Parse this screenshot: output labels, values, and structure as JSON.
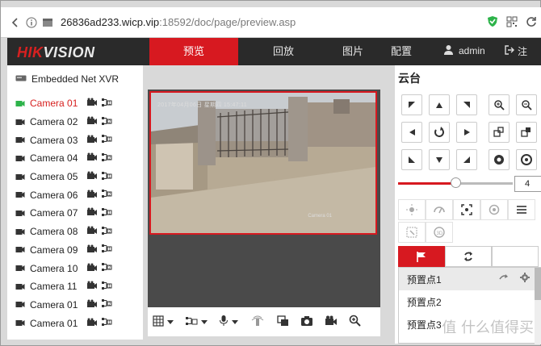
{
  "browser": {
    "url_host": "26836ad233.wicp.vip",
    "url_path": ":18592/doc/page/preview.asp"
  },
  "header": {
    "logo_part1": "HIK",
    "logo_part2": "VISION",
    "tabs": [
      {
        "label": "预览",
        "active": true
      },
      {
        "label": "回放"
      },
      {
        "label": "图片"
      },
      {
        "label": "配置"
      }
    ],
    "user": "admin",
    "logout": "注"
  },
  "left": {
    "device": "Embedded Net XVR",
    "cameras": [
      {
        "name": "Camera 01",
        "active": true
      },
      {
        "name": "Camera 02"
      },
      {
        "name": "Camera 03"
      },
      {
        "name": "Camera 04"
      },
      {
        "name": "Camera 05"
      },
      {
        "name": "Camera 06"
      },
      {
        "name": "Camera 07"
      },
      {
        "name": "Camera 08"
      },
      {
        "name": "Camera 09"
      },
      {
        "name": "Camera 10"
      },
      {
        "name": "Camera 11"
      },
      {
        "name": "Camera 01"
      },
      {
        "name": "Camera 01"
      }
    ]
  },
  "video": {
    "timestamp": "2017年04月06日 星期四 15:47:11",
    "camera_label": "Camera 01"
  },
  "ptz": {
    "title": "云台",
    "speed": "4",
    "speed_level": 0.5,
    "presets": [
      {
        "label": "预置点1",
        "selected": true
      },
      {
        "label": "预置点2"
      },
      {
        "label": "预置点3"
      }
    ]
  },
  "watermark": "值 什么值得买",
  "colors": {
    "accent": "#d71920",
    "header_bg": "#2a2a2a"
  }
}
